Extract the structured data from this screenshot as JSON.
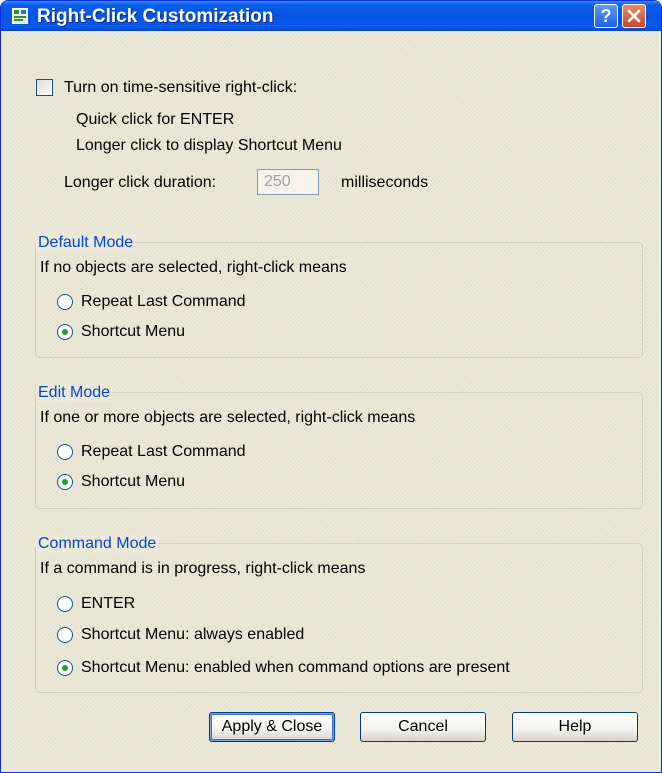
{
  "window": {
    "title": "Right-Click Customization"
  },
  "time_sensitive": {
    "checkbox_label": "Turn on time-sensitive right-click:",
    "checked": false,
    "line1": "Quick click for ENTER",
    "line2": "Longer click to display Shortcut Menu",
    "duration_label": "Longer click duration:",
    "duration_value": "250",
    "duration_unit": "milliseconds"
  },
  "default_mode": {
    "title": "Default Mode",
    "description": "If no objects are selected, right-click means",
    "options": [
      "Repeat Last Command",
      "Shortcut Menu"
    ],
    "selected": 1
  },
  "edit_mode": {
    "title": "Edit Mode",
    "description": "If one or more objects are selected, right-click means",
    "options": [
      "Repeat Last Command",
      "Shortcut Menu"
    ],
    "selected": 1
  },
  "command_mode": {
    "title": "Command Mode",
    "description": "If a command is in progress, right-click means",
    "options": [
      "ENTER",
      "Shortcut Menu: always enabled",
      "Shortcut Menu: enabled when command options are present"
    ],
    "selected": 2
  },
  "buttons": {
    "apply": "Apply & Close",
    "cancel": "Cancel",
    "help": "Help"
  },
  "colors": {
    "titlebar": "#0454e3",
    "group_title": "#0046d5",
    "radio_dot": "#21a121"
  }
}
